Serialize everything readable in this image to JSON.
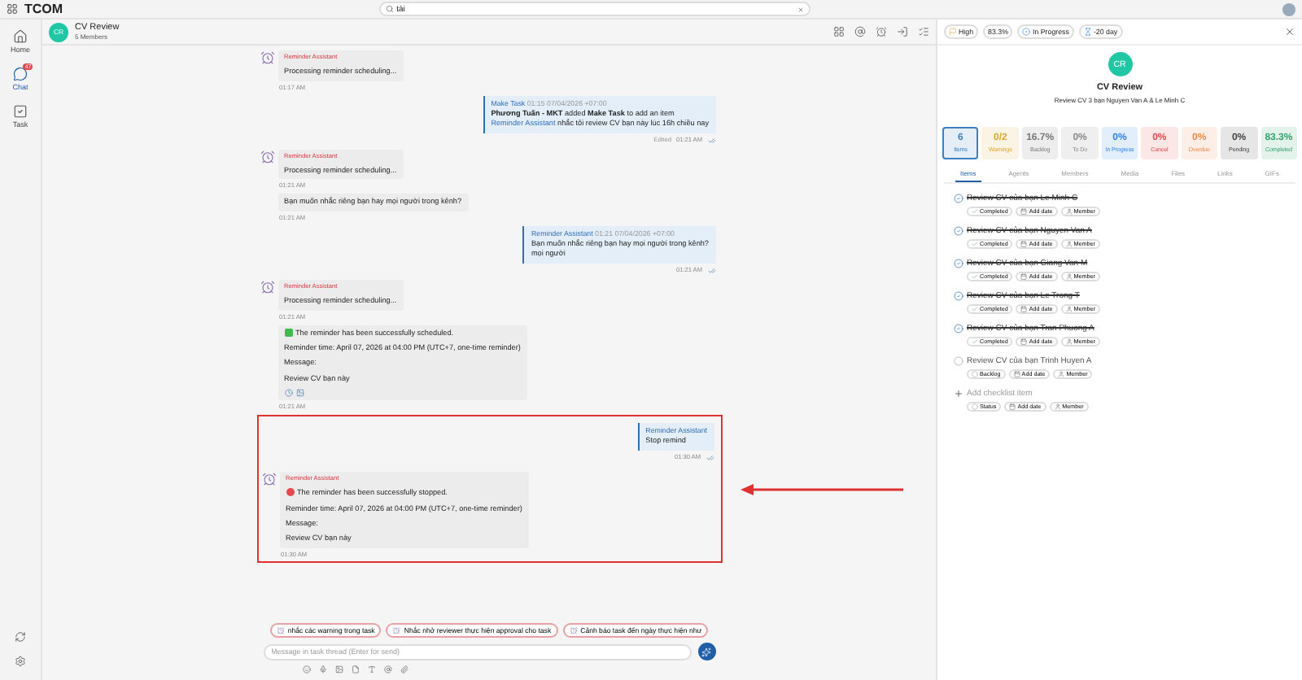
{
  "app": {
    "title": "TCOM",
    "search": {
      "value": "tài"
    }
  },
  "nav": [
    {
      "label": "Home",
      "selected": false
    },
    {
      "label": "Chat",
      "selected": true,
      "badge": "47"
    },
    {
      "label": "Task",
      "selected": false
    }
  ],
  "chat": {
    "avatar": "CR",
    "title": "CV Review",
    "subtitle": "5 Members"
  },
  "messages": [
    {
      "kind": "bot",
      "sender": "Reminder Assistant",
      "text": "Processing reminder scheduling...",
      "time": "01:17 AM",
      "highlighted": false
    },
    {
      "kind": "quote",
      "title": "Make Task",
      "stamp": "01:15 07/04/2026 +07:00",
      "lines": [
        "**Phương Tuấn - MKT** added **Make Task** to add an item"
      ],
      "mention": "Reminder Assistant",
      "mention_text": "nhắc tôi review CV bạn này lúc 16h chiều nay",
      "edited": "Edited",
      "time": "01:21 AM",
      "highlighted": false
    },
    {
      "kind": "bot",
      "sender": "Reminder Assistant",
      "text": "Processing reminder scheduling...",
      "time": "01:21 AM",
      "highlighted": false
    },
    {
      "kind": "plain",
      "text": "Bạn muốn nhắc riêng bạn hay mọi người trong kênh?",
      "time": "01:21 AM",
      "highlighted": false
    },
    {
      "kind": "quote",
      "title": "Reminder Assistant",
      "stamp": "01:21 07/04/2026 +07:00",
      "lines": [
        "Bạn muốn nhắc riêng bạn hay mọi người trong kênh?",
        "mọi người"
      ],
      "time": "01:21 AM",
      "highlighted": false
    },
    {
      "kind": "bot",
      "sender": "Reminder Assistant",
      "text": "Processing reminder scheduling...",
      "time": "01:21 AM",
      "highlighted": false
    },
    {
      "kind": "result",
      "success": true,
      "lines": [
        "The reminder has been successfully scheduled.",
        "Reminder time: April 07, 2026 at 04:00 PM (UTC+7, one-time reminder)",
        "Message:",
        "Review CV bạn này"
      ],
      "reactions": true,
      "time": "01:21 AM",
      "highlighted": false
    },
    {
      "kind": "quote",
      "title": "Reminder Assistant",
      "lines": [
        "Stop remind"
      ],
      "time": "01:30 AM",
      "highlighted": true
    },
    {
      "kind": "result",
      "sender": "Reminder Assistant",
      "success": false,
      "lines": [
        "The reminder has been successfully stopped.",
        "Reminder time: April 07, 2026 at 04:00 PM (UTC+7, one-time reminder)",
        "Message:",
        "Review CV bạn này"
      ],
      "reactions": false,
      "time": "01:30 AM",
      "highlighted": true
    }
  ],
  "suggestions": [
    "nhắc các warning trong task",
    "Nhắc nhở reviewer thực hiện approval cho task",
    "Cảnh báo task đến ngày thực hiện như"
  ],
  "composer": {
    "placeholder": "Message in task thread (Enter for send)"
  },
  "task": {
    "priority": "High",
    "progress": "83.3%",
    "state": "In Progress",
    "due": "-20 day",
    "avatar": "CR",
    "title": "CV Review",
    "description": "Review CV 3 bạn Nguyen Van A & Le Minh C",
    "stats": [
      {
        "value": "6",
        "label": "Items",
        "color": "#3b7fc4",
        "selected": true
      },
      {
        "value": "0/2",
        "label": "Warnings",
        "color": "#e3a52b",
        "selected": false
      },
      {
        "value": "16.7%",
        "label": "Backlog",
        "color": "#777777",
        "selected": false
      },
      {
        "value": "0%",
        "label": "To Do",
        "color": "#888888",
        "selected": false
      },
      {
        "value": "0%",
        "label": "In Progress",
        "color": "#2f80ed",
        "selected": false
      },
      {
        "value": "0%",
        "label": "Cancel",
        "color": "#e5484d",
        "selected": false
      },
      {
        "value": "0%",
        "label": "Overdue",
        "color": "#f08a4b",
        "selected": false
      },
      {
        "value": "0%",
        "label": "Pending",
        "color": "#444444",
        "selected": false
      },
      {
        "value": "83.3%",
        "label": "Completed",
        "color": "#30a46c",
        "selected": false
      }
    ],
    "tabs": [
      {
        "label": "Items",
        "selected": true
      },
      {
        "label": "Agents",
        "selected": false
      },
      {
        "label": "Members",
        "selected": false
      },
      {
        "label": "Media",
        "selected": false
      },
      {
        "label": "Files",
        "selected": false
      },
      {
        "label": "Links",
        "selected": false
      },
      {
        "label": "GIFs",
        "selected": false
      }
    ],
    "items": [
      {
        "title": "Review CV của bạn Le Minh C",
        "checked": true,
        "status": "Completed",
        "date": "Add date",
        "member": "Member"
      },
      {
        "title": "Review CV của bạn Nguyen Van A",
        "checked": true,
        "status": "Completed",
        "date": "Add date",
        "member": "Member"
      },
      {
        "title": "Review CV của bạn Giang Van M",
        "checked": true,
        "status": "Completed",
        "date": "Add date",
        "member": "Member"
      },
      {
        "title": "Review CV của bạn Le Trong T",
        "checked": true,
        "status": "Completed",
        "date": "Add date",
        "member": "Member"
      },
      {
        "title": "Review CV của bạn Tran Phuong A",
        "checked": true,
        "status": "Completed",
        "date": "Add date",
        "member": "Member"
      },
      {
        "title": "Review CV của bạn Trinh Huyen A",
        "checked": false,
        "status": "Backlog",
        "date": "Add date",
        "member": "Member"
      }
    ],
    "add": {
      "label": "Add checklist item",
      "status": "Status",
      "date": "Add date",
      "member": "Member"
    }
  }
}
